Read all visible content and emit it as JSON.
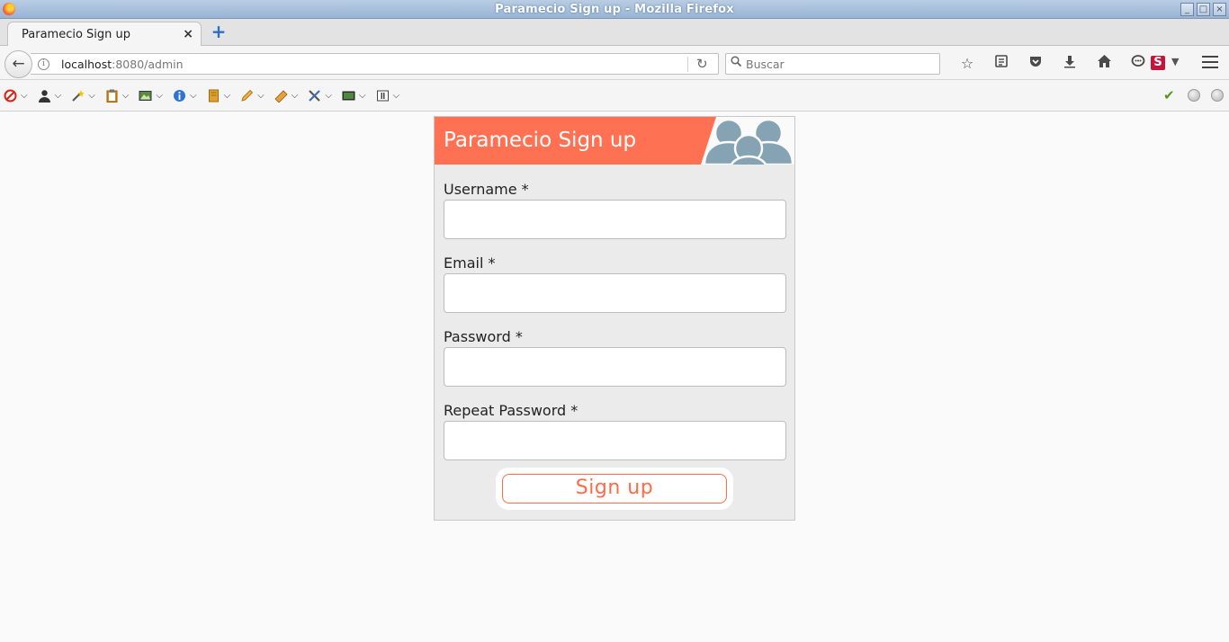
{
  "window": {
    "title": "Paramecio Sign up - Mozilla Firefox",
    "buttons": [
      "_",
      "□",
      "×"
    ]
  },
  "tabs": [
    {
      "label": "Paramecio Sign up",
      "close": "×"
    }
  ],
  "new_tab": "+",
  "navbar": {
    "url_host": "localhost",
    "url_rest": ":8080/admin",
    "search_placeholder": "Buscar",
    "icons": [
      "bookmark-star-icon",
      "reading-list-icon",
      "pocket-icon",
      "download-icon",
      "home-icon",
      "chat-icon"
    ],
    "extension_letter": "S"
  },
  "ext_toolbar": {
    "items": [
      "disable-icon",
      "user-icon",
      "wand-icon",
      "clipboard-icon",
      "image-icon",
      "info-icon",
      "css-icon",
      "pencil-icon",
      "ruler-icon",
      "tools-icon",
      "console-icon",
      "layout-icon"
    ],
    "status_colors": {
      "ok": "#4f9a1e"
    }
  },
  "form": {
    "heading": "Paramecio Sign up",
    "accent": "#ff7152",
    "fields": [
      {
        "label": "Username *",
        "value": ""
      },
      {
        "label": "Email *",
        "value": ""
      },
      {
        "label": "Password *",
        "value": ""
      },
      {
        "label": "Repeat Password *",
        "value": ""
      }
    ],
    "submit_label": "Sign up"
  }
}
